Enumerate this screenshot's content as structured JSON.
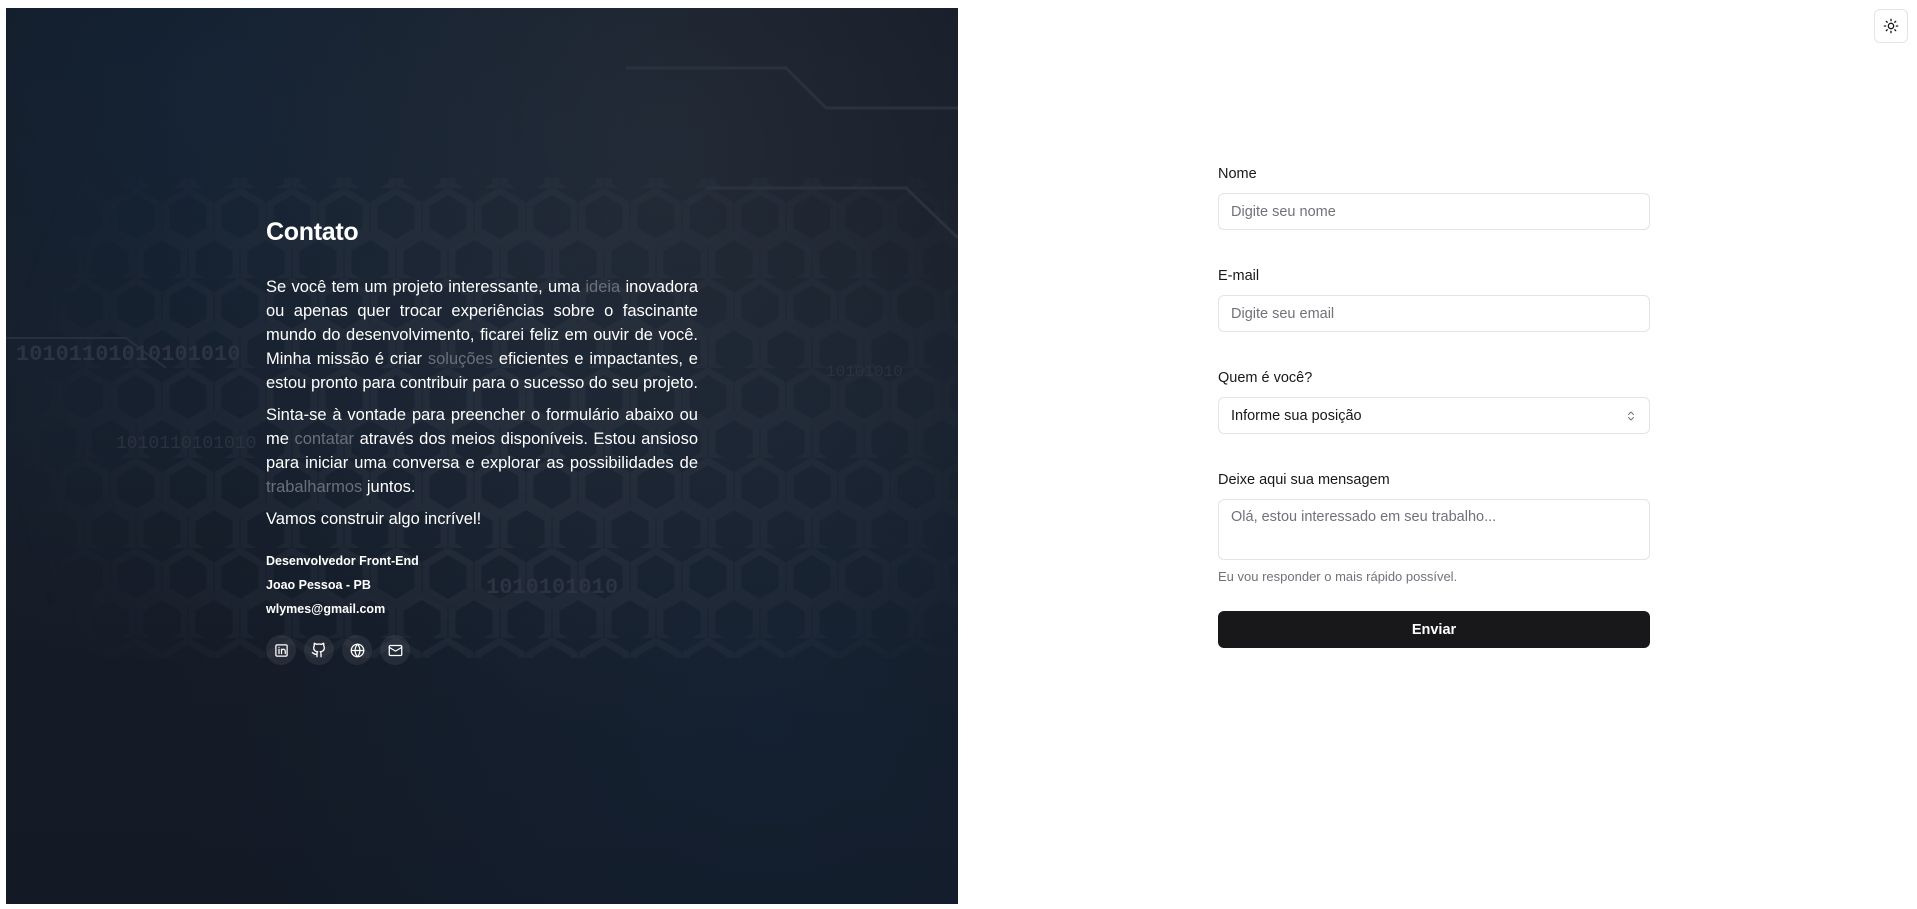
{
  "hero": {
    "title": "Contato",
    "p1": {
      "a": "Se você tem um projeto interessante, uma ",
      "hl1": "ideia",
      "b": " inovadora ou apenas quer trocar experiências sobre o fascinante mundo do desenvolvimento, ficarei feliz em ouvir de você. Minha missão é criar ",
      "hl2": "soluções",
      "c": " eficientes e impactantes, e estou pronto para contribuir para o sucesso do seu projeto."
    },
    "p2": {
      "a": "Sinta-se à vontade para preencher o formulário abaixo ou me ",
      "hl1": "contatar",
      "b": " através dos meios disponíveis. Estou ansioso para iniciar uma conversa e explorar as possibilidades de ",
      "hl2": "trabalharmos",
      "c": " juntos."
    },
    "p3": "Vamos construir algo incrível!",
    "role": "Desenvolvedor Front-End",
    "location": "Joao Pessoa - PB",
    "email": "wlymes@gmail.com",
    "socials": [
      "linkedin-icon",
      "github-icon",
      "globe-icon",
      "mail-icon"
    ]
  },
  "theme_toggle": {
    "icon": "sun-icon"
  },
  "form": {
    "name_label": "Nome",
    "name_placeholder": "Digite seu nome",
    "email_label": "E-mail",
    "email_placeholder": "Digite seu email",
    "role_label": "Quem é você?",
    "role_value": "Informe sua posição",
    "message_label": "Deixe aqui sua mensagem",
    "message_placeholder": "Olá, estou interessado em seu trabalho...",
    "hint": "Eu vou responder o mais rápido possível.",
    "submit_label": "Enviar"
  },
  "colors": {
    "accent_dark": "#18181b",
    "muted": "#71717a",
    "border": "#e4e4e7",
    "hero_bg": "#161c27",
    "hero_highlight": "#6b6f78"
  }
}
